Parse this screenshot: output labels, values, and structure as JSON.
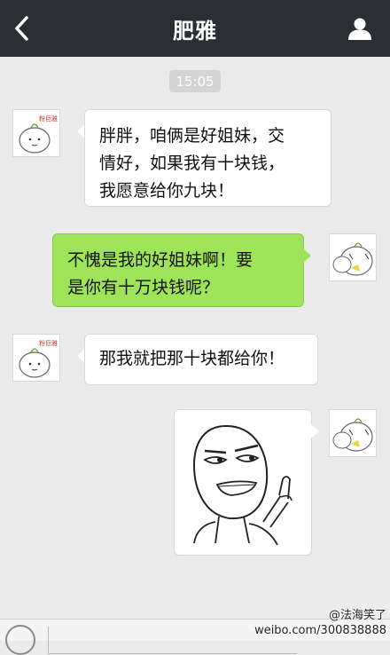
{
  "header": {
    "title": "肥雅",
    "back_icon": "chevron-left-icon",
    "profile_icon": "person-icon"
  },
  "timestamp": "15:05",
  "messages": [
    {
      "side": "left",
      "lines": [
        "胖胖，咱俩是好姐妹，交",
        "情好，如果我有十块钱，",
        "我愿意给你九块！"
      ]
    },
    {
      "side": "right",
      "lines": [
        "不愧是我的好姐妹啊！要",
        "是你有十万块钱呢？"
      ]
    },
    {
      "side": "left",
      "lines": [
        "那我就把那十块都给你！"
      ]
    },
    {
      "side": "right",
      "sticker": "rage-face-middle-finger-sticker"
    }
  ],
  "avatars": {
    "left_caption": "粉巨雅"
  },
  "watermark": {
    "handle": "@法海笑了",
    "url": "weibo.com/300838888"
  },
  "colors": {
    "topbar": "#2b2f33",
    "background": "#ebebeb",
    "green_bubble": "#9fe358",
    "white_bubble": "#ffffff"
  }
}
